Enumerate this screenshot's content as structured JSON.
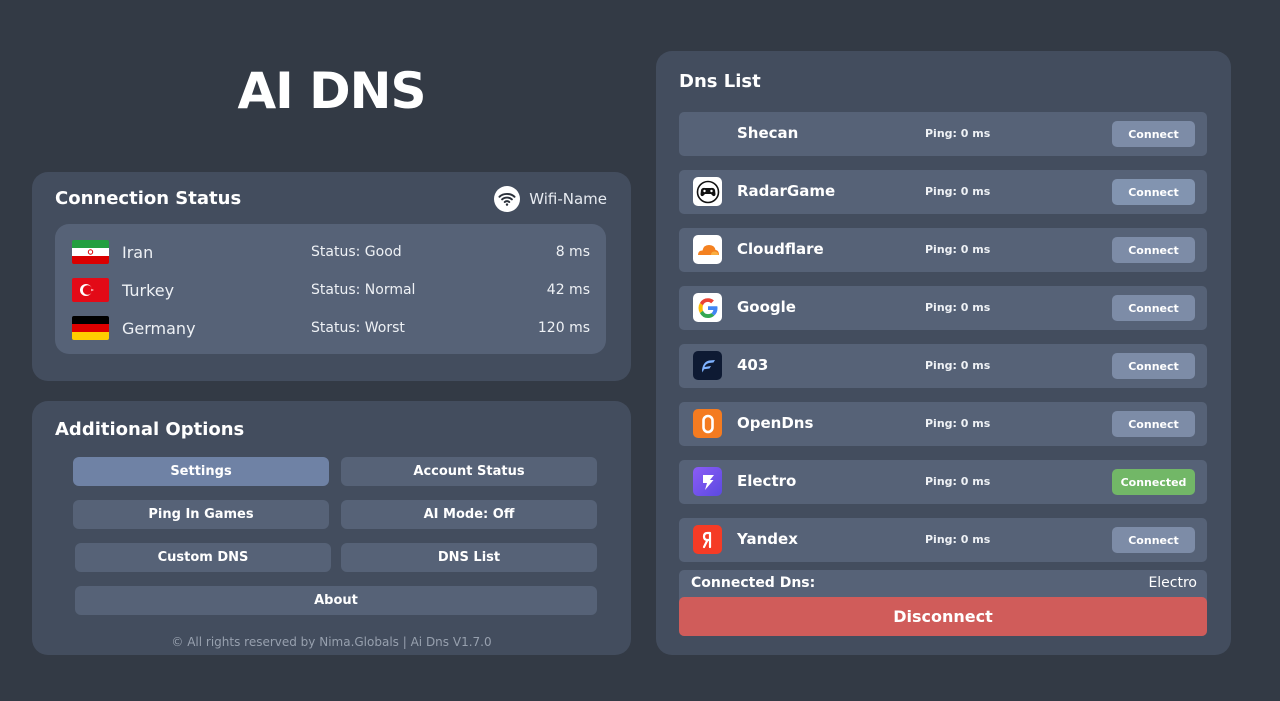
{
  "app": {
    "title": "AI DNS"
  },
  "connection_status": {
    "title": "Connection Status",
    "wifi_name": "Wifi-Name",
    "countries": [
      {
        "flag": "iran-flag",
        "name": "Iran",
        "status": "Status: Good",
        "ping": "8 ms"
      },
      {
        "flag": "turkey-flag",
        "name": "Turkey",
        "status": "Status: Normal",
        "ping": "42 ms"
      },
      {
        "flag": "germany-flag",
        "name": "Germany",
        "status": "Status: Worst",
        "ping": "120 ms"
      }
    ]
  },
  "additional_options": {
    "title": "Additional Options",
    "buttons": {
      "settings": "Settings",
      "account_status": "Account Status",
      "ping_in_games": "Ping In Games",
      "ai_mode": "AI Mode: Off",
      "custom_dns": "Custom DNS",
      "dns_list": "DNS List",
      "about": "About"
    },
    "footer": "© All rights reserved by Nima.Globals | Ai Dns V1.7.0"
  },
  "dns_list": {
    "title": "Dns List",
    "items": [
      {
        "name": "Shecan",
        "ping": "Ping: 0 ms",
        "button": "Connect",
        "icon": "shecan-logo"
      },
      {
        "name": "RadarGame",
        "ping": "Ping: 0 ms",
        "button": "Connect",
        "icon": "gamepad-logo"
      },
      {
        "name": "Cloudflare",
        "ping": "Ping: 0 ms",
        "button": "Connect",
        "icon": "cloud-logo"
      },
      {
        "name": "Google",
        "ping": "Ping: 0 ms",
        "button": "Connect",
        "icon": "google-logo"
      },
      {
        "name": "403",
        "ping": "Ping: 0 ms",
        "button": "Connect",
        "icon": "403-logo"
      },
      {
        "name": "OpenDns",
        "ping": "Ping: 0 ms",
        "button": "Connect",
        "icon": "opendns-logo"
      },
      {
        "name": "Electro",
        "ping": "Ping: 0 ms",
        "button": "Connected",
        "icon": "lightning-logo"
      },
      {
        "name": "Yandex",
        "ping": "Ping: 0 ms",
        "button": "Connect",
        "icon": "yandex-logo"
      }
    ],
    "connected_label": "Connected Dns:",
    "connected_value": "Electro",
    "disconnect_label": "Disconnect"
  },
  "colors": {
    "background": "#333a45",
    "card": "#434d5e",
    "row": "#566277",
    "active_button": "#6f82a5",
    "connect_button": "#7d8ca7",
    "connected_button": "#72b767",
    "disconnect_button": "#d05c5a"
  }
}
